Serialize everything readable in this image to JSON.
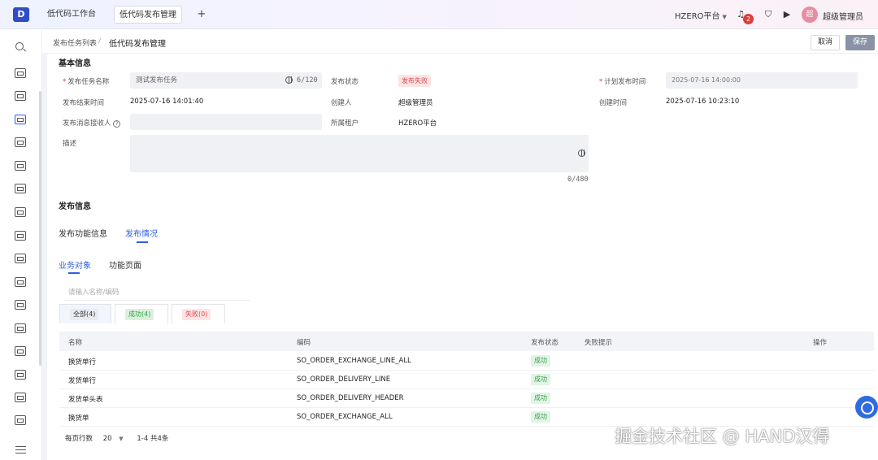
{
  "topbar": {
    "logo_text": "D",
    "tabs": [
      {
        "label": "低代码工作台",
        "active": false
      },
      {
        "label": "低代码发布管理",
        "active": true
      }
    ],
    "add_tab": "+",
    "tenant": "HZERO平台",
    "notification_count": "2",
    "avatar_text": "超",
    "username": "超级管理员"
  },
  "breadcrumb": {
    "parent": "发布任务列表",
    "separator": "/",
    "current": "低代码发布管理"
  },
  "actions": {
    "cancel_label": "取消",
    "save_label": "保存"
  },
  "basic_info": {
    "title": "基本信息",
    "task_name_label": "发布任务名称",
    "task_name_value": "测试发布任务",
    "task_name_counter": "6/120",
    "status_label": "发布状态",
    "status_value": "发布失败",
    "planned_time_label": "计划发布时间",
    "planned_time_value": "2025-07-16 14:00:00",
    "end_time_label": "发布结束时间",
    "end_time_value": "2025-07-16 14:01:40",
    "creator_label": "创建人",
    "creator_value": "超级管理员",
    "created_time_label": "创建时间",
    "created_time_value": "2025-07-16 10:23:10",
    "receiver_label": "发布消息接收人",
    "tenant_label": "所属租户",
    "tenant_value": "HZERO平台",
    "description_label": "描述",
    "description_counter": "0/480"
  },
  "publish_info": {
    "title": "发布信息",
    "tabs": [
      "发布功能信息",
      "发布情况"
    ],
    "subtabs": [
      "业务对象",
      "功能页面"
    ],
    "search_placeholder": "请输入名称/编码",
    "filters": [
      {
        "label": "全部(4)"
      },
      {
        "label": "成功(4)"
      },
      {
        "label": "失败(0)"
      }
    ]
  },
  "colors": {
    "accent": "#2f5fe0",
    "success": "#39a24a",
    "danger": "#e0464e"
  },
  "table": {
    "headers": [
      "名称",
      "编码",
      "发布状态",
      "失败提示",
      "操作"
    ],
    "rows": [
      {
        "name": "换货单行",
        "code": "SO_ORDER_EXCHANGE_LINE_ALL",
        "status": "成功",
        "error": ""
      },
      {
        "name": "发货单行",
        "code": "SO_ORDER_DELIVERY_LINE",
        "status": "成功",
        "error": ""
      },
      {
        "name": "发货单头表",
        "code": "SO_ORDER_DELIVERY_HEADER",
        "status": "成功",
        "error": ""
      },
      {
        "name": "换货单",
        "code": "SO_ORDER_EXCHANGE_ALL",
        "status": "成功",
        "error": ""
      }
    ]
  },
  "pager": {
    "page_size_label": "每页行数",
    "page_size": "20",
    "range": "1-4",
    "total": "共4条"
  },
  "watermark": "掘金技术社区 @ HAND汉得"
}
